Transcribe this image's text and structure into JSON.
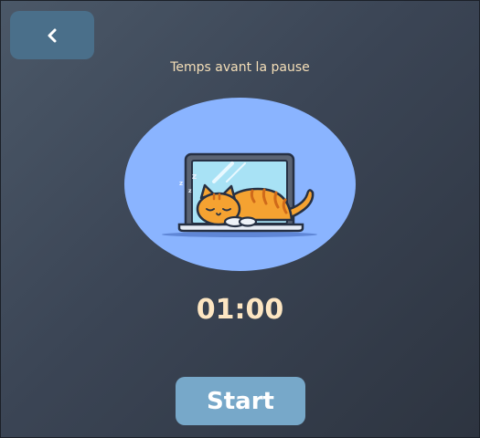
{
  "header": {
    "back_icon": "chevron-left-icon"
  },
  "main": {
    "subtitle": "Temps avant la pause",
    "illustration": "sleeping-cat-on-laptop",
    "timer": "01:00",
    "start_label": "Start"
  },
  "colors": {
    "background": "#3b4555",
    "back_button": "#4a6f8a",
    "start_button": "#77a8c9",
    "illustration_bg": "#8ab4ff",
    "accent_text": "#fde6c2"
  }
}
